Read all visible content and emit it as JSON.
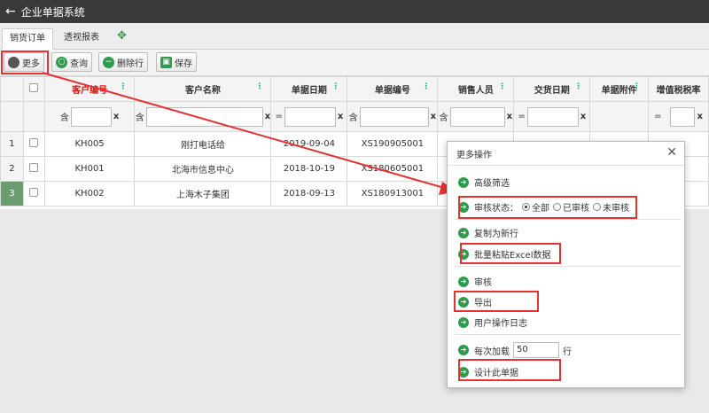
{
  "app": {
    "title": "企业单据系统",
    "back_icon": "arrow-left-icon"
  },
  "tabs": [
    "销货订单",
    "透视报表"
  ],
  "toolbar": {
    "more": "更多",
    "query": "查询",
    "delete_row": "删除行",
    "save": "保存"
  },
  "grid": {
    "headers": [
      "客户编号",
      "客户名称",
      "单据日期",
      "单据编号",
      "销售人员",
      "交货日期",
      "单据附件",
      "增值税税率"
    ],
    "filter_ops": [
      "含",
      "含",
      "=",
      "含",
      "含",
      "=",
      "",
      "="
    ],
    "rows": [
      {
        "num": "1",
        "cust_no": "KH005",
        "cust_name": "刚打电话给",
        "date": "2019-09-04",
        "doc_no": "XS190905001"
      },
      {
        "num": "2",
        "cust_no": "KH001",
        "cust_name": "北海市信息中心",
        "date": "2018-10-19",
        "doc_no": "XS180605001"
      },
      {
        "num": "3",
        "cust_no": "KH002",
        "cust_name": "上海木子集团",
        "date": "2018-09-13",
        "doc_no": "XS180913001"
      }
    ]
  },
  "dialog": {
    "title": "更多操作",
    "advanced_filter": "高级筛选",
    "audit_status_label": "审核状态：",
    "audit_options": [
      "全部",
      "已审核",
      "未审核"
    ],
    "audit_selected": "全部",
    "copy_new_row": "复制为新行",
    "batch_paste": "批量粘贴Excel数据",
    "audit": "审核",
    "export": "导出",
    "user_log": "用户操作日志",
    "load_label": "每次加载",
    "load_value": "50",
    "load_unit": "行",
    "design": "设计此单据"
  },
  "colors": {
    "annotation": "#e53333",
    "accent": "#2e9c4c",
    "titlebar": "#3a3a3a"
  }
}
